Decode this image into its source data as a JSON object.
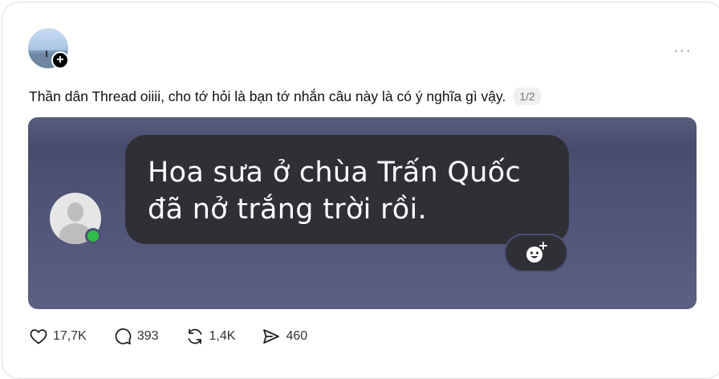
{
  "post": {
    "text": "Thần dân Thread oiiii, cho tớ hỏi là bạn tớ nhắn câu này là có ý nghĩa gì vậy.",
    "page_indicator": "1/2",
    "follow_symbol": "+",
    "more_symbol": "···"
  },
  "media": {
    "message_lines": [
      "Hoa sưa ở chùa Trấn Quốc",
      "đã nở trắng trời rồi."
    ],
    "bubble_color": "#2f2f36",
    "background_color": "#4c5072",
    "online_color": "#2fbd4a"
  },
  "actions": {
    "likes": "17,7K",
    "comments": "393",
    "reposts": "1,4K",
    "shares": "460"
  },
  "icons": [
    "heart-icon",
    "comment-icon",
    "repost-icon",
    "share-icon",
    "more-icon",
    "add-reaction-icon",
    "follow-plus-icon"
  ]
}
